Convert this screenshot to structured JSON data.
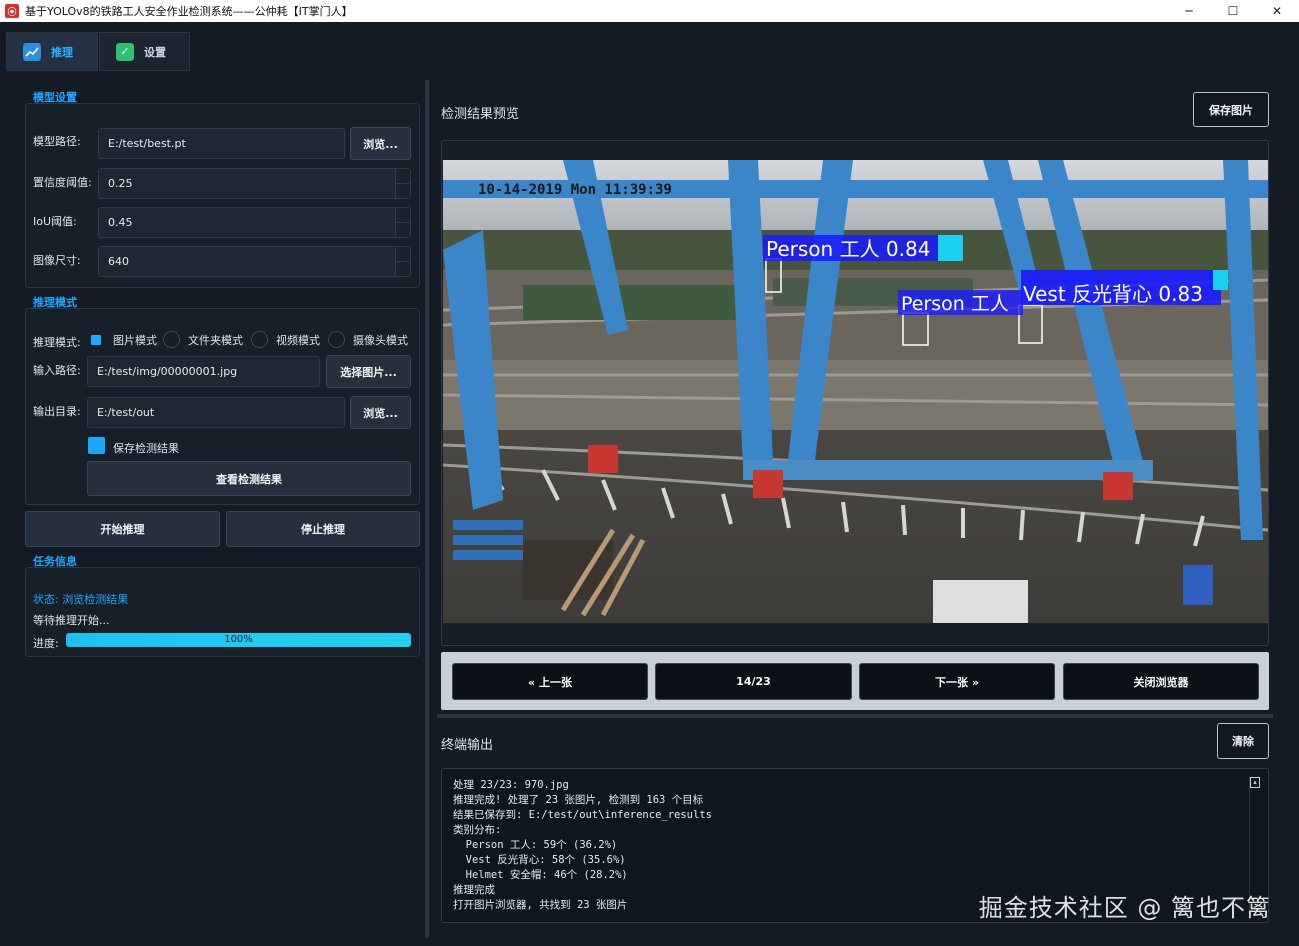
{
  "window": {
    "title": "基于YOLOv8的铁路工人安全作业检测系统——公仲耗【IT掌门人】",
    "icon": "app-logo-icon",
    "controls": {
      "minimize": "─",
      "maximize": "☐",
      "close": "✕"
    }
  },
  "tabs": [
    {
      "label": "推理",
      "icon": "chart-line-icon",
      "active": true
    },
    {
      "label": "设置",
      "icon": "checkbox-icon",
      "active": false
    }
  ],
  "model": {
    "section_title": "模型设置",
    "path_label": "模型路径:",
    "path_value": "E:/test/best.pt",
    "browse_label": "浏览...",
    "conf_label": "置信度阈值:",
    "conf_value": "0.25",
    "iou_label": "IoU阈值:",
    "iou_value": "0.45",
    "imgsz_label": "图像尺寸:",
    "imgsz_value": "640"
  },
  "inference": {
    "section_title": "推理模式",
    "mode_label": "推理模式:",
    "modes": [
      "图片模式",
      "文件夹模式",
      "视频模式",
      "摄像头模式"
    ],
    "selected_mode": "图片模式",
    "input_label": "输入路径:",
    "input_value": "E:/test/img/00000001.jpg",
    "select_image_label": "选择图片...",
    "output_label": "输出目录:",
    "output_value": "E:/test/out",
    "output_browse_label": "浏览...",
    "save_results_label": "保存检测结果",
    "save_results_checked": true,
    "view_results_label": "查看检测结果",
    "start_label": "开始推理",
    "stop_label": "停止推理"
  },
  "task": {
    "section_title": "任务信息",
    "status": "状态: 浏览检测结果",
    "waiting": "等待推理开始...",
    "progress_label": "进度:",
    "progress_value": 100,
    "progress_text": "100%"
  },
  "preview": {
    "title": "检测结果预览",
    "save_image_label": "保存图片",
    "timestamp": "10-14-2019 Mon 11:39:39",
    "detections": [
      {
        "label": "Person 工人 0.84",
        "color": "#1a1aff"
      },
      {
        "label": "Vest 反光背心 0.83",
        "color": "#1a1aff"
      },
      {
        "label": "Person 工人",
        "color": "#1a1aff"
      }
    ],
    "prev_label": "« 上一张",
    "counter": "14/23",
    "next_label": "下一张 »",
    "close_label": "关闭浏览器"
  },
  "console": {
    "title": "终端输出",
    "clear_label": "清除",
    "lines": [
      "处理 23/23: 970.jpg",
      "推理完成! 处理了 23 张图片, 检测到 163 个目标",
      "结果已保存到: E:/test/out\\inference_results",
      "类别分布:",
      "  Person 工人: 59个 (36.2%)",
      "  Vest 反光背心: 58个 (35.6%)",
      "  Helmet 安全帽: 46个 (28.2%)",
      "推理完成",
      "打开图片浏览器, 共找到 23 张图片"
    ]
  },
  "watermark": "掘金技术社区 @ 篱也不篱",
  "colors": {
    "background": "#141b24",
    "accent": "#1ea7ff",
    "progress": "#22c8ef",
    "detection_box": "#1a1aff"
  }
}
